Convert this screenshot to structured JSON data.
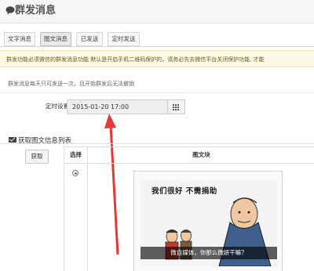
{
  "header": {
    "title": "群发消息",
    "icon": "chat-bubble-icon"
  },
  "tabs": [
    {
      "label": "文字消息",
      "active": false
    },
    {
      "label": "图文消息",
      "active": true
    },
    {
      "label": "已发送",
      "active": false
    },
    {
      "label": "定时发送",
      "active": false
    }
  ],
  "notice": {
    "text": "群发功能必须微信的群发消息功能 默认是开启手机二维码保护的，请务必先去微信平台关闭保护功能, 才能"
  },
  "hint": "群发消息每天只可发送一次，且开始群发后无法撤销",
  "schedule": {
    "label": "定时设置",
    "value": "2015-01-20 17:00",
    "picker_icon": "calendar-grid-icon"
  },
  "section": {
    "title": "获取图文信息列表",
    "icon": "envelope-icon"
  },
  "fetch_button": "获取",
  "table": {
    "headers": [
      "选择",
      "图文块"
    ],
    "rows": [
      {
        "selected": true,
        "image_text": "我们很好 不需捐助",
        "caption": "微自媒体，你那么微妍干嘛？"
      }
    ]
  },
  "colors": {
    "notice_bg": "#fcf8e3",
    "arrow": "#e53935",
    "radio_dot": "#3c9b3c"
  }
}
